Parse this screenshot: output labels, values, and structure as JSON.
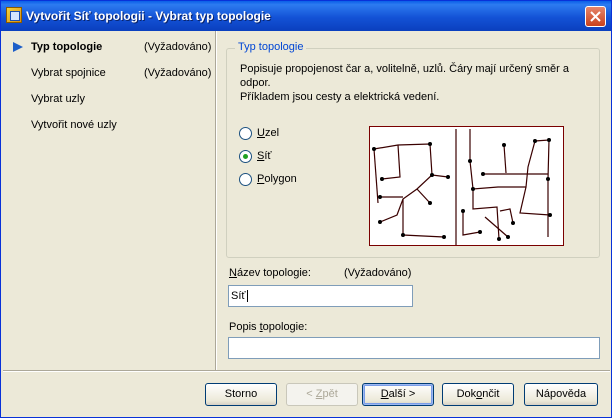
{
  "window": {
    "title": "Vytvořit Síť topologii - Vybrat typ topologie",
    "app_icon": "topology-wizard-icon",
    "close_icon": "close-icon"
  },
  "nav": {
    "items": [
      {
        "label": "Typ topologie",
        "required": "(Vyžadováno)",
        "active": true
      },
      {
        "label": "Vybrat spojnice",
        "required": "(Vyžadováno)",
        "active": false
      },
      {
        "label": "Vybrat uzly",
        "required": "",
        "active": false
      },
      {
        "label": "Vytvořit nové uzly",
        "required": "",
        "active": false
      }
    ]
  },
  "topology_group": {
    "title": "Typ topologie",
    "description_line1": "Popisuje propojenost čar a, volitelně, uzlů. Čáry mají určený směr a odpor.",
    "description_line2": "Příkladem jsou cesty a elektrická vedení.",
    "options": [
      {
        "underlined": "U",
        "rest": "zel",
        "selected": false
      },
      {
        "underlined": "S",
        "rest": "íť",
        "selected": true
      },
      {
        "underlined": "P",
        "rest": "olygon",
        "selected": false
      }
    ]
  },
  "name_field": {
    "label_underlined": "N",
    "label_rest": "ázev topologie:",
    "required": "(Vyžadováno)",
    "value": "Síť"
  },
  "description_field": {
    "label_prefix": "Popis ",
    "label_underlined": "t",
    "label_rest": "opologie:",
    "value": ""
  },
  "buttons": {
    "cancel": "Storno",
    "back_prefix": "< ",
    "back_underlined": "Z",
    "back_rest": "pět",
    "next_underlined": "D",
    "next_rest": "alší >",
    "finish_prefix": "Dok",
    "finish_underlined": "o",
    "finish_rest": "nčit",
    "help": "Nápověda"
  }
}
